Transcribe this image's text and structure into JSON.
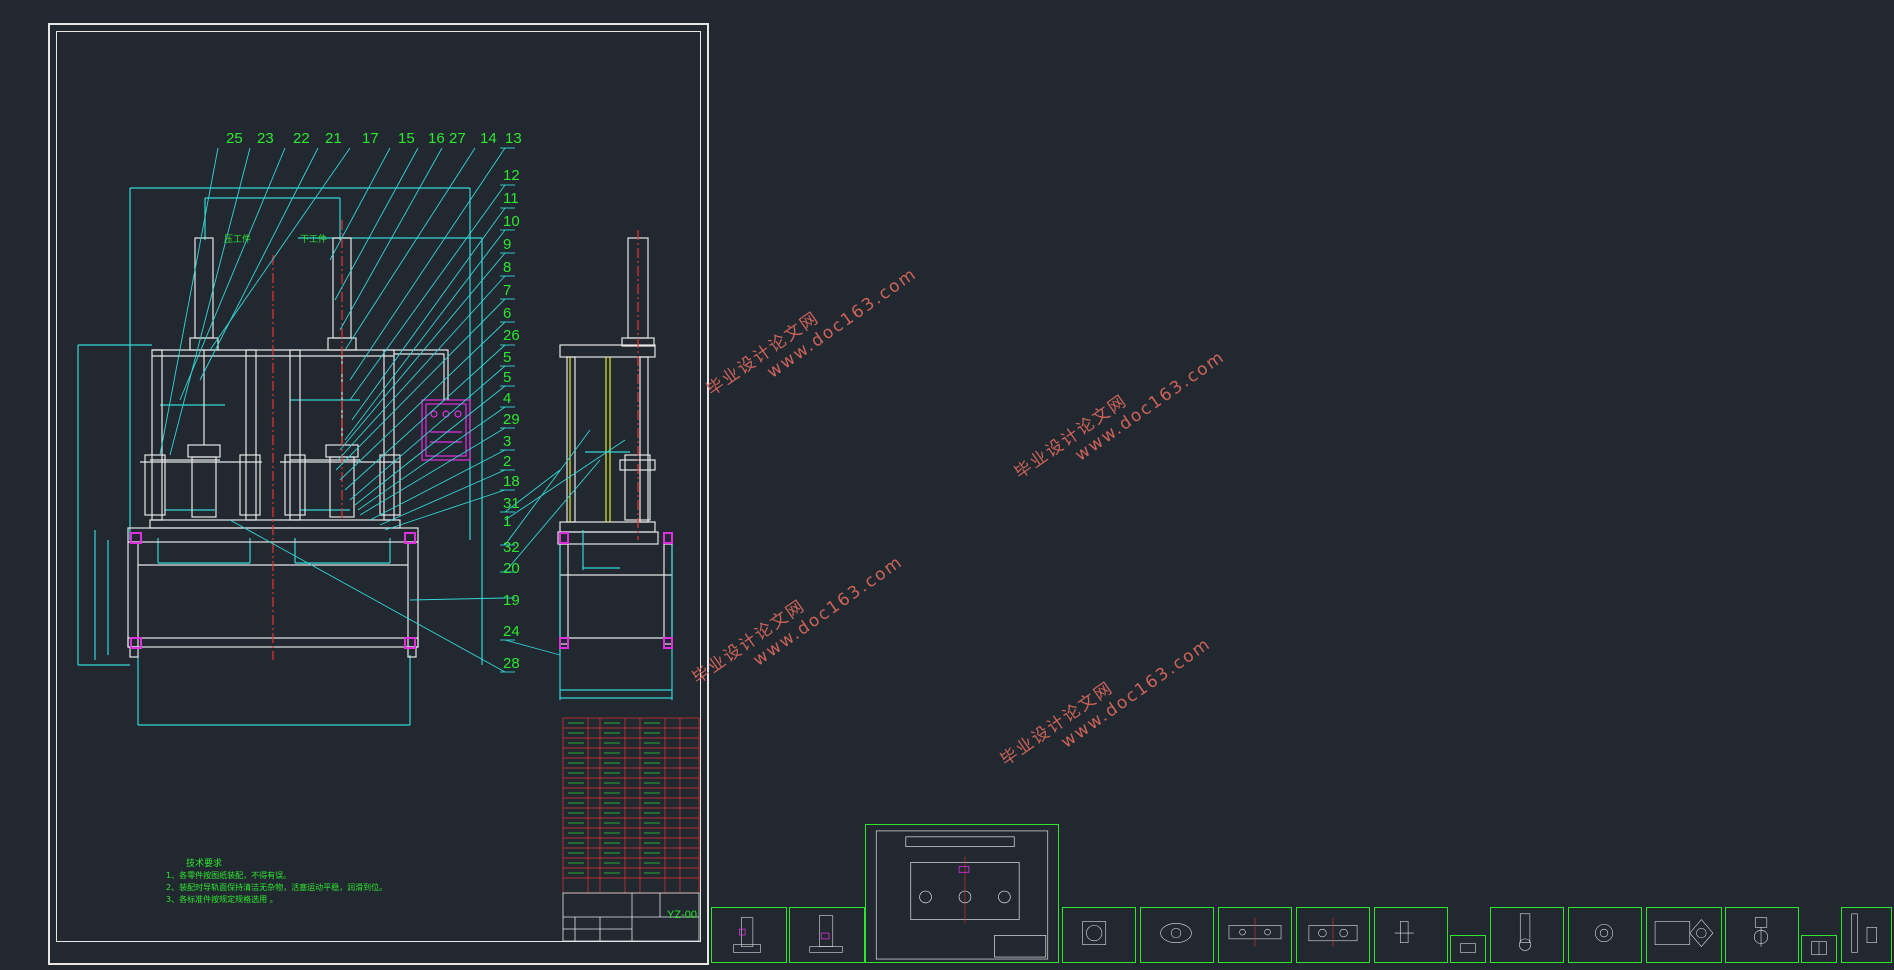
{
  "drawing": {
    "callouts_top": [
      "25",
      "23",
      "22",
      "21",
      "17",
      "15",
      "16",
      "27",
      "14",
      "13"
    ],
    "callouts_right": [
      "12",
      "11",
      "10",
      "9",
      "8",
      "7",
      "6",
      "26",
      "5",
      "5",
      "4",
      "29",
      "3",
      "2",
      "18",
      "31",
      "1",
      "32",
      "20",
      "19",
      "24",
      "28"
    ],
    "drawing_code": "YZ-00",
    "station_label_left": "压工件",
    "station_label_right": "下工件"
  },
  "notes": {
    "title": "技术要求",
    "lines": [
      "1、各零件按图纸装配，不得有误。",
      "2、装配时导轨面保持清洁无杂物，活塞运动平稳，润滑到位。",
      "3、各标准件按规定规格选用 。"
    ]
  },
  "watermarks": [
    {
      "cn": "毕业设计论文网",
      "url": "www.doc163.com"
    },
    {
      "cn": "毕业设计论文网",
      "url": "www.doc163.com"
    },
    {
      "cn": "毕业设计论文网",
      "url": "www.doc163.com"
    },
    {
      "cn": "毕业设计论文网",
      "url": "www.doc163.com"
    }
  ],
  "colors": {
    "background": "#212830",
    "frame": "#e6e6e6",
    "cyan": "#33d6d6",
    "green": "#2fe62f",
    "magenta": "#e12ee1",
    "red": "#e63232",
    "yellow": "#e6e62f",
    "watermark": "#e06a5e"
  }
}
